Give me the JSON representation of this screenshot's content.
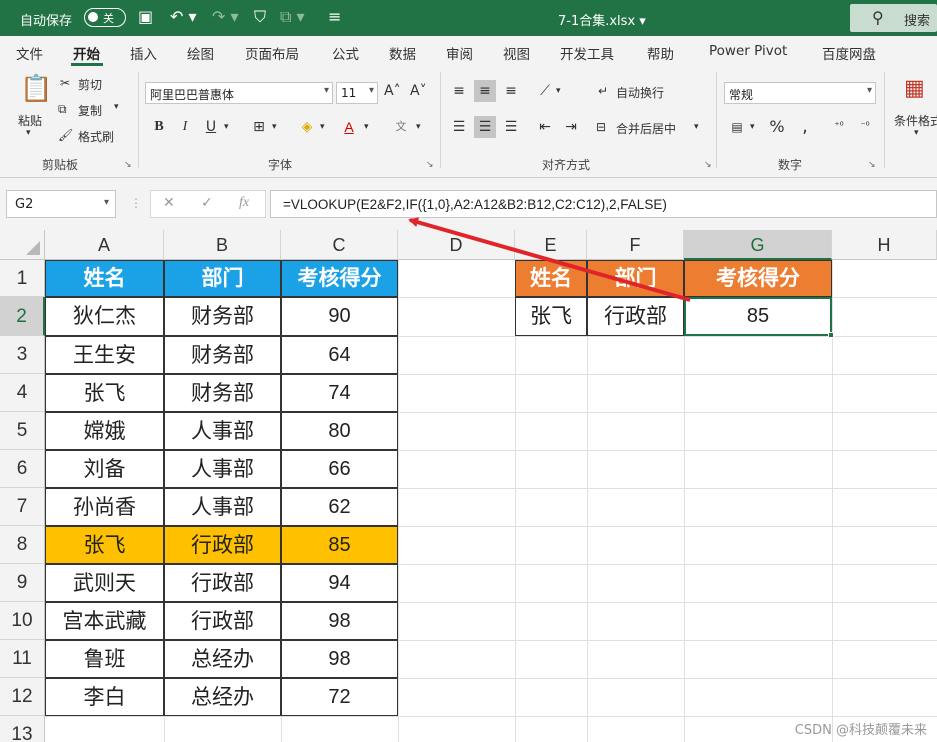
{
  "titlebar": {
    "autosave_label": "自动保存",
    "autosave_state": "关",
    "filename": "7-1合集.xlsx ▾",
    "search_label": "搜索"
  },
  "ribbon_tabs": [
    "文件",
    "开始",
    "插入",
    "绘图",
    "页面布局",
    "公式",
    "数据",
    "审阅",
    "视图",
    "开发工具",
    "帮助",
    "Power Pivot",
    "百度网盘"
  ],
  "active_tab": "开始",
  "clipboard": {
    "paste": "粘贴",
    "cut": "剪切",
    "copy": "复制",
    "format_painter": "格式刷",
    "group": "剪贴板"
  },
  "font": {
    "name": "阿里巴巴普惠体",
    "size": "11",
    "bold": "B",
    "italic": "I",
    "underline": "U",
    "group": "字体"
  },
  "alignment": {
    "wrap_text": "自动换行",
    "merge_center": "合并后居中",
    "group": "对齐方式"
  },
  "number": {
    "format": "常规",
    "group": "数字"
  },
  "styles": {
    "conditional_format": "条件格式"
  },
  "formula_bar": {
    "name_box": "G2",
    "formula": "=VLOOKUP(E2&F2,IF({1,0},A2:A12&B2:B12,C2:C12),2,FALSE)"
  },
  "columns": [
    "A",
    "B",
    "C",
    "D",
    "E",
    "F",
    "G",
    "H"
  ],
  "rows": [
    "1",
    "2",
    "3",
    "4",
    "5",
    "6",
    "7",
    "8",
    "9",
    "10",
    "11",
    "12",
    "13"
  ],
  "selected_cell": "G2",
  "table": {
    "headers": [
      "姓名",
      "部门",
      "考核得分"
    ],
    "rows": [
      [
        "狄仁杰",
        "财务部",
        "90"
      ],
      [
        "王生安",
        "财务部",
        "64"
      ],
      [
        "张飞",
        "财务部",
        "74"
      ],
      [
        "嫦娥",
        "人事部",
        "80"
      ],
      [
        "刘备",
        "人事部",
        "66"
      ],
      [
        "孙尚香",
        "人事部",
        "62"
      ],
      [
        "张飞",
        "行政部",
        "85"
      ],
      [
        "武则天",
        "行政部",
        "94"
      ],
      [
        "宫本武藏",
        "行政部",
        "98"
      ],
      [
        "鲁班",
        "总经办",
        "98"
      ],
      [
        "李白",
        "总经办",
        "72"
      ]
    ],
    "highlight_row": 7
  },
  "lookup": {
    "headers": [
      "姓名",
      "部门",
      "考核得分"
    ],
    "values": [
      "张飞",
      "行政部",
      "85"
    ]
  },
  "colors": {
    "excel_green": "#217346",
    "source_header": "#1aa1e6",
    "lookup_header": "#ed7d31",
    "highlight": "#ffc000",
    "arrow": "#e0252a"
  },
  "watermark": "CSDN @科技颠覆未来"
}
